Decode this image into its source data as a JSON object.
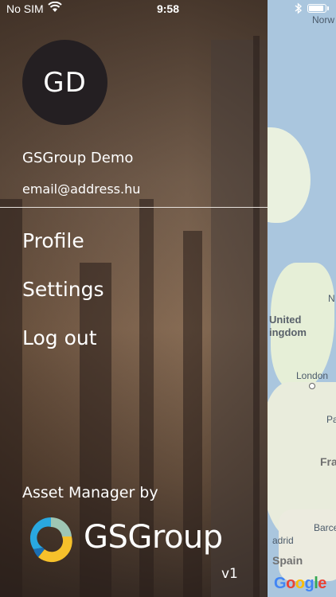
{
  "status_bar": {
    "carrier": "No SIM",
    "time": "9:58"
  },
  "map": {
    "labels": {
      "norw": "Norw",
      "n": "N",
      "united": "United",
      "kingdom": "ingdom",
      "london": "London",
      "pa": "Pa",
      "fra": "Fra",
      "barce": "Barce",
      "madrid": "adrid",
      "spain": "Spain"
    },
    "attribution": [
      "G",
      "o",
      "o",
      "g",
      "l",
      "e"
    ]
  },
  "drawer": {
    "avatar_initials": "GD",
    "user_name": "GSGroup Demo",
    "user_email": "email@address.hu",
    "menu": [
      {
        "label": "Profile"
      },
      {
        "label": "Settings"
      },
      {
        "label": "Log out"
      }
    ],
    "byline": "Asset Manager by",
    "brand": "GSGroup",
    "version": "v1"
  }
}
